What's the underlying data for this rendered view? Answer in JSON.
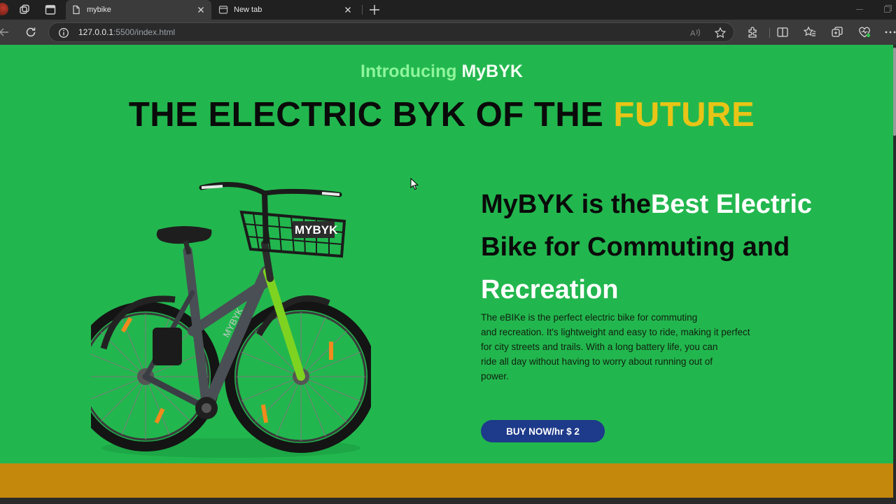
{
  "browser": {
    "tabs": [
      {
        "title": "mybike",
        "active": true
      },
      {
        "title": "New tab",
        "active": false
      }
    ],
    "url_host": "127.0.0.1",
    "url_path": ":5500/index.html"
  },
  "hero": {
    "intro_prefix": "Introducing ",
    "intro_brand": "MyBYK",
    "headline_main": "THE ELECTRIC BYK OF THE ",
    "headline_accent": "FUTURE"
  },
  "bike_image": {
    "basket_logo": "MYBYK",
    "frame_logo": "MYBYK"
  },
  "content": {
    "tagline_start": "MyBYK is the",
    "tagline_highlight": "Best Electric",
    "tagline_line2": "Bike for Commuting and",
    "tagline_line3": "Recreation",
    "description_lines": [
      "The eBIKe is the perfect electric bike for commuting",
      "and recreation. It's lightweight and easy to ride, making it perfect",
      "for city streets and trails. With a long battery life, you can",
      "ride all day without having to worry about running out of",
      "power."
    ],
    "buy_label": "BUY NOW/hr $ 2"
  },
  "colors": {
    "page_bg": "#22b74e",
    "accent_yellow": "#e8c417",
    "button_blue": "#1e3a8a",
    "footer_band": "#c4880c"
  }
}
